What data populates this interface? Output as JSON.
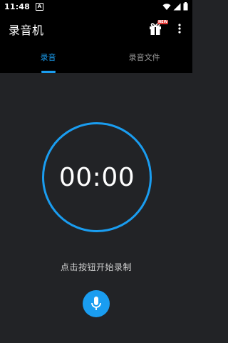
{
  "status_bar": {
    "time": "11:48",
    "notification_glyph": "A"
  },
  "app_bar": {
    "title": "录音机",
    "gift_badge": "NEW"
  },
  "tabs": [
    {
      "label": "录音",
      "active": true
    },
    {
      "label": "录音文件",
      "active": false
    }
  ],
  "timer": {
    "value": "00:00"
  },
  "hint": "点击按钮开始录制",
  "colors": {
    "accent": "#1a9df0",
    "background": "#222326",
    "bar": "#000000"
  },
  "icons": {
    "gift": "gift-icon",
    "more": "more-vert-icon",
    "mic": "microphone-icon"
  }
}
